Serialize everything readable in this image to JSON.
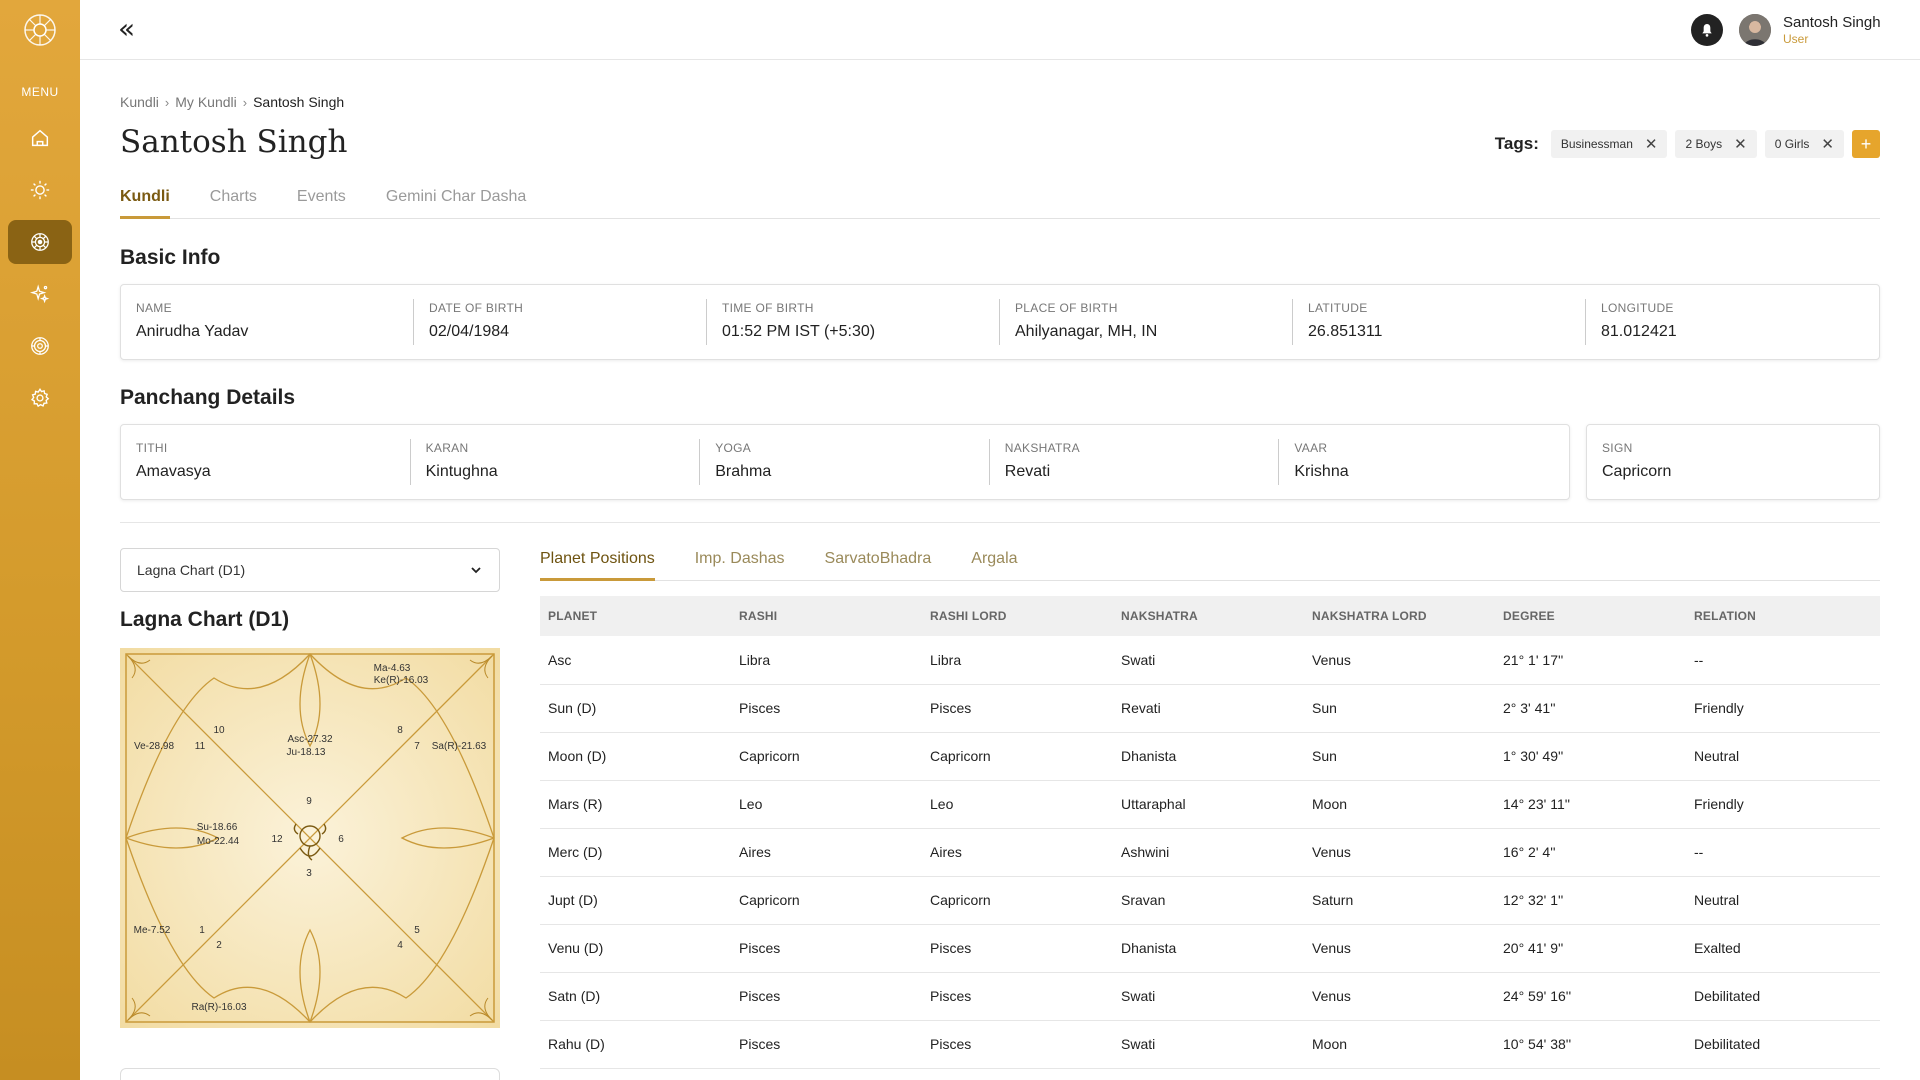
{
  "sidebar": {
    "menu_label": "MENU",
    "items": [
      {
        "icon": "home-icon"
      },
      {
        "icon": "sun-icon"
      },
      {
        "icon": "mandala-icon"
      },
      {
        "icon": "sparkle-icon"
      },
      {
        "icon": "zodiac-wheel-icon"
      },
      {
        "icon": "gear-icon"
      }
    ]
  },
  "header": {
    "collapse_icon": "double-chevron-left-icon",
    "user_name": "Santosh Singh",
    "user_role": "User"
  },
  "breadcrumb": [
    "Kundli",
    "My Kundli",
    "Santosh Singh"
  ],
  "page_title": "Santosh Singh",
  "tags": {
    "label": "Tags:",
    "items": [
      "Businessman",
      "2 Boys",
      "0 Girls"
    ],
    "add_label": "+"
  },
  "main_tabs": [
    "Kundli",
    "Charts",
    "Events",
    "Gemini Char Dasha"
  ],
  "basic_info": {
    "title": "Basic Info",
    "fields": [
      {
        "label": "NAME",
        "value": "Anirudha Yadav"
      },
      {
        "label": "DATE OF BIRTH",
        "value": "02/04/1984"
      },
      {
        "label": "TIME OF BIRTH",
        "value": "01:52 PM IST (+5:30)"
      },
      {
        "label": "PLACE OF BIRTH",
        "value": "Ahilyanagar, MH, IN"
      },
      {
        "label": "LATITUDE",
        "value": "26.851311"
      },
      {
        "label": "LONGITUDE",
        "value": "81.012421"
      }
    ]
  },
  "panchang": {
    "title": "Panchang Details",
    "fields": [
      {
        "label": "TITHI",
        "value": "Amavasya"
      },
      {
        "label": "KARAN",
        "value": "Kintughna"
      },
      {
        "label": "YOGA",
        "value": "Brahma"
      },
      {
        "label": "NAKSHATRA",
        "value": "Revati"
      },
      {
        "label": "VAAR",
        "value": "Krishna"
      }
    ],
    "sign": {
      "label": "SIGN",
      "value": "Capricorn"
    }
  },
  "chart_select": {
    "value": "Lagna Chart (D1)"
  },
  "chart_title": "Lagna Chart (D1)",
  "kundli": {
    "houses": [
      "1",
      "2",
      "3",
      "4",
      "5",
      "6",
      "7",
      "8",
      "9",
      "10",
      "11",
      "12"
    ],
    "placements": [
      "Ma-4.63",
      "Ke(R)-16.03",
      "Ve-28.98",
      "Asc-27.32",
      "Ju-18.13",
      "Sa(R)-21.63",
      "Su-18.66",
      "Mo-22.44",
      "Me-7.52",
      "Ra(R)-16.03"
    ]
  },
  "sub_tabs": [
    "Planet Positions",
    "Imp. Dashas",
    "SarvatoBhadra",
    "Argala"
  ],
  "planet_table": {
    "headers": [
      "PLANET",
      "RASHI",
      "RASHI LORD",
      "NAKSHATRA",
      "NAKSHATRA LORD",
      "DEGREE",
      "RELATION"
    ],
    "rows": [
      [
        "Asc",
        "Libra",
        "Libra",
        "Swati",
        "Venus",
        "21° 1' 17''",
        "--"
      ],
      [
        "Sun (D)",
        "Pisces",
        "Pisces",
        "Revati",
        "Sun",
        " 2° 3' 41''",
        "Friendly"
      ],
      [
        "Moon (D)",
        "Capricorn",
        "Capricorn",
        "Dhanista",
        "Sun",
        "1° 30' 49''",
        "Neutral"
      ],
      [
        "Mars (R)",
        "Leo",
        "Leo",
        "Uttaraphal",
        "Moon",
        "14° 23' 11''",
        "Friendly"
      ],
      [
        "Merc (D)",
        "Aires",
        "Aires",
        "Ashwini",
        "Venus",
        "16° 2' 4''",
        "--"
      ],
      [
        "Jupt (D)",
        "Capricorn",
        "Capricorn",
        "Sravan",
        "Saturn",
        "12° 32' 1''",
        "Neutral"
      ],
      [
        "Venu (D)",
        "Pisces",
        "Pisces",
        "Dhanista",
        "Venus",
        "20° 41' 9''",
        "Exalted"
      ],
      [
        "Satn (D)",
        "Pisces",
        "Pisces",
        "Swati",
        "Venus",
        "24° 59' 16''",
        "Debilitated"
      ],
      [
        "Rahu (D)",
        "Pisces",
        "Pisces",
        "Swati",
        "Moon",
        "10° 54' 38''",
        "Debilitated"
      ]
    ]
  },
  "colors": {
    "accent": "#d9a033",
    "active_nav": "#8a6314",
    "tab_active": "#7a5a12",
    "chart_bg": "#f7e6b8",
    "chart_line": "#c99a3a"
  }
}
